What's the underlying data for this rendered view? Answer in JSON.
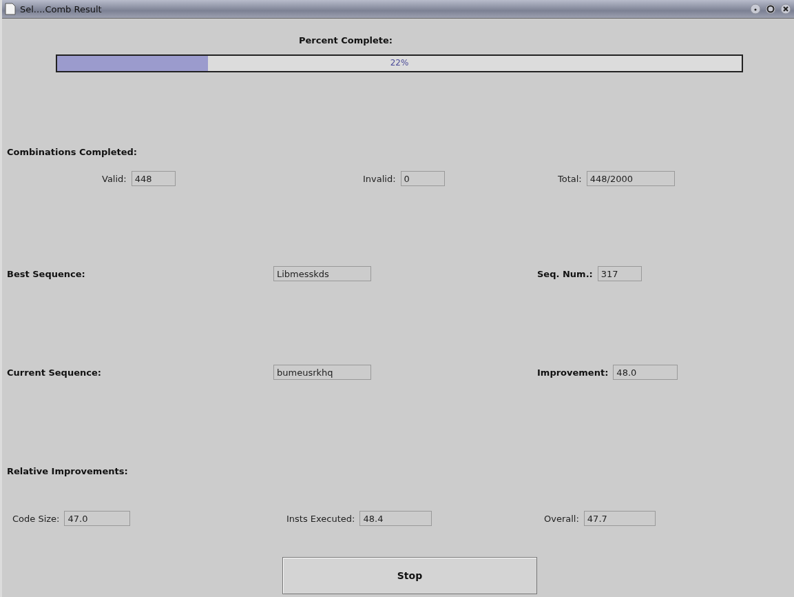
{
  "window": {
    "title": "Sel....Comb Result"
  },
  "progress": {
    "label": "Percent Complete:",
    "level": 0.22,
    "reading": "22%"
  },
  "combinations": {
    "heading": "Combinations Completed:",
    "fields": [
      {
        "label": "Valid:",
        "value": "448"
      },
      {
        "label": "Invalid:",
        "value": "0"
      },
      {
        "label": "Total:",
        "value": "448/2000"
      }
    ]
  },
  "best": {
    "label": "Best Sequence:",
    "value": "Libmesskds",
    "side_label": "Seq. Num.:",
    "side_value": "317"
  },
  "current": {
    "label": "Current Sequence:",
    "value": "bumeusrkhq",
    "side_label": "Improvement:",
    "side_value": "48.0"
  },
  "relative": {
    "heading": "Relative Improvements:",
    "fields": [
      {
        "label": "Code Size:",
        "value": "47.0"
      },
      {
        "label": "Insts Executed:",
        "value": "48.4"
      },
      {
        "label": "Overall:",
        "value": "47.7"
      }
    ]
  },
  "stop_button": "Stop"
}
